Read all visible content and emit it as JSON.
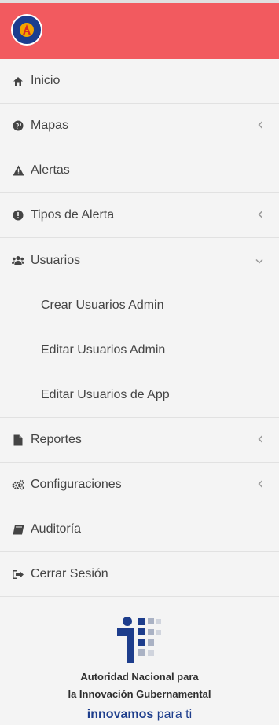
{
  "menu": {
    "inicio": "Inicio",
    "mapas": "Mapas",
    "alertas": "Alertas",
    "tipos_alerta": "Tipos de Alerta",
    "usuarios": "Usuarios",
    "usuarios_sub": [
      "Crear Usuarios Admin",
      "Editar Usuarios Admin",
      "Editar Usuarios de App"
    ],
    "reportes": "Reportes",
    "configuraciones": "Configuraciones",
    "auditoria": "Auditoría",
    "cerrar_sesion": "Cerrar Sesión"
  },
  "footer": {
    "org_line1": "Autoridad Nacional para",
    "org_line2": "la Innovación Gubernamental",
    "tag_bold": "innovamos",
    "tag_rest": " para ti"
  },
  "colors": {
    "header": "#f25a5f",
    "brand_blue": "#1d3d8c"
  },
  "icons": {
    "inicio": "home-icon",
    "mapas": "globe-icon",
    "alertas": "warning-icon",
    "tipos_alerta": "exclamation-circle-icon",
    "usuarios": "users-icon",
    "reportes": "file-icon",
    "configuraciones": "gears-icon",
    "auditoria": "book-icon",
    "cerrar_sesion": "sign-out-icon"
  }
}
